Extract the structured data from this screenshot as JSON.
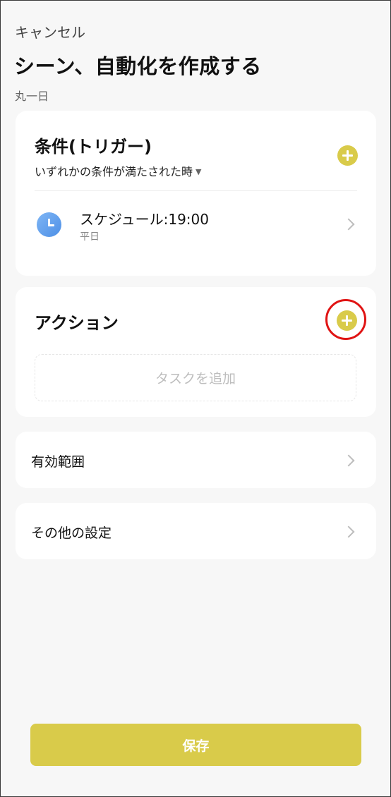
{
  "header": {
    "cancel_label": "キャンセル",
    "title": "シーン、自動化を作成する",
    "subtitle": "丸一日"
  },
  "conditions": {
    "title": "条件(トリガー)",
    "mode_label": "いずれかの条件が満たされた時",
    "items": [
      {
        "title": "スケジュール:19:00",
        "subtitle": "平日",
        "icon": "clock-icon"
      }
    ]
  },
  "actions": {
    "title": "アクション",
    "add_task_label": "タスクを追加"
  },
  "settings": {
    "scope_label": "有効範囲",
    "other_label": "その他の設定"
  },
  "footer": {
    "save_label": "保存"
  },
  "colors": {
    "accent": "#d9cb4a",
    "highlight": "#e01414",
    "background": "#f7f7f7",
    "clock": "#5b9be9"
  }
}
